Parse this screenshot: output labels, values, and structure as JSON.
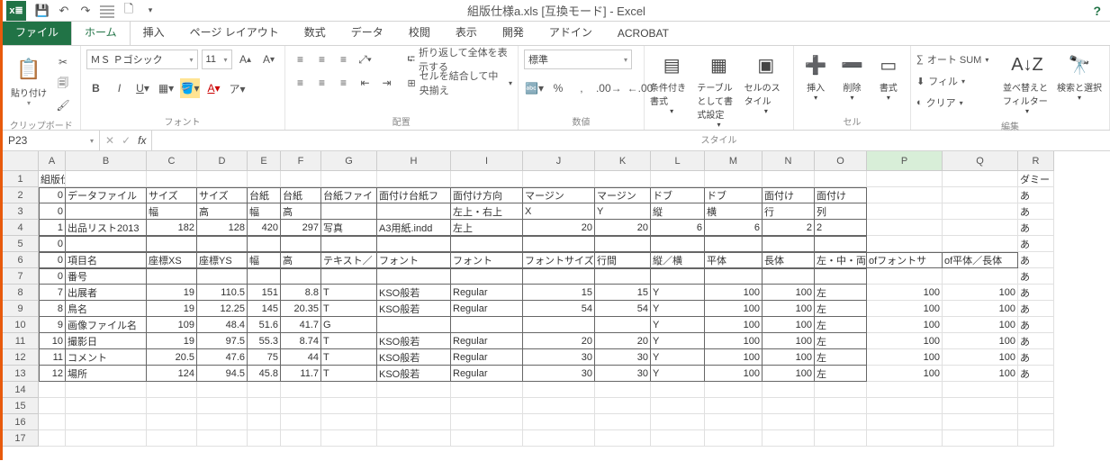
{
  "title": "組版仕様a.xls  [互換モード] - Excel",
  "qat": {
    "save": "save-icon",
    "undo": "undo-icon",
    "redo": "redo-icon",
    "new": "new-doc-icon"
  },
  "tabs": [
    "ファイル",
    "ホーム",
    "挿入",
    "ページ レイアウト",
    "数式",
    "データ",
    "校閲",
    "表示",
    "開発",
    "アドイン",
    "ACROBAT"
  ],
  "active_tab": 1,
  "ribbon": {
    "clipboard": {
      "label": "クリップボード",
      "paste": "貼り付け"
    },
    "font": {
      "label": "フォント",
      "name": "ＭＳ Ｐゴシック",
      "size": "11"
    },
    "alignment": {
      "label": "配置",
      "wrap": "折り返して全体を表示する",
      "merge": "セルを結合して中央揃え"
    },
    "number": {
      "label": "数値",
      "format": "標準"
    },
    "styles": {
      "label": "スタイル",
      "cond": "条件付き書式",
      "tbl": "テーブルとして書式設定",
      "cell": "セルのスタイル"
    },
    "cells": {
      "label": "セル",
      "insert": "挿入",
      "delete": "削除",
      "format": "書式"
    },
    "editing": {
      "label": "編集",
      "sum": "オート SUM",
      "fill": "フィル",
      "clear": "クリア",
      "sort": "並べ替えとフィルター",
      "find": "検索と選択"
    }
  },
  "name_box": "P23",
  "fx_value": "",
  "col_widths": {
    "A": 30,
    "B": 90,
    "C": 56,
    "D": 56,
    "E": 37,
    "F": 45,
    "G": 62,
    "H": 82,
    "I": 80,
    "J": 80,
    "K": 62,
    "L": 60,
    "M": 64,
    "N": 58,
    "O": 58,
    "P": 84,
    "Q": 84,
    "R": 40
  },
  "row_count": 17,
  "active_col": "P",
  "active_row": 23,
  "grid": {
    "r1": {
      "A": "組版仕様",
      "R": "ダミー"
    },
    "r2": {
      "A": "0",
      "B": "データファイル",
      "C": "サイズ",
      "D": "サイズ",
      "E": "台紙",
      "F": "台紙",
      "G": "台紙ファイ",
      "H": "面付け台紙フ",
      "I": "面付け方向",
      "J": "マージン",
      "K": "マージン",
      "L": "ドブ",
      "M": "ドブ",
      "N": "面付け",
      "O": "面付け",
      "R": "あ"
    },
    "r3": {
      "A": "0",
      "C": "幅",
      "D": "高",
      "E": "幅",
      "F": "高",
      "I": "左上・右上",
      "J": "X",
      "K": "Y",
      "L": "縦",
      "M": "横",
      "N": "行",
      "O": "列",
      "R": "あ"
    },
    "r4": {
      "A": "1",
      "B": "出品リスト2013",
      "C": "182",
      "D": "128",
      "E": "420",
      "F": "297",
      "G": "写真",
      "H": "A3用紙.indd",
      "I": "左上",
      "J": "20",
      "K": "20",
      "L": "6",
      "M": "6",
      "N": "2",
      "O": "2",
      "R": "あ"
    },
    "r5": {
      "A": "0",
      "R": "あ"
    },
    "r6": {
      "A": "0",
      "B": "項目名",
      "C": "座標XS",
      "D": "座標YS",
      "E": "幅",
      "F": "高",
      "G": "テキスト／",
      "H": "フォント",
      "I": "フォント",
      "J": "フォントサイズ",
      "K": "行間",
      "L": "縦／横",
      "M": "平体",
      "N": "長体",
      "O": "左・中・両",
      "P": "ofフォントサ",
      "Q": "of平体／長体",
      "R": "あ"
    },
    "r7": {
      "A": "0",
      "B": "番号",
      "R": "あ"
    },
    "r8": {
      "A": "7",
      "B": "出展者",
      "C": "19",
      "D": "110.5",
      "E": "151",
      "F": "8.8",
      "G": "T",
      "H": "KSO般若",
      "I": "Regular",
      "J": "15",
      "K": "15",
      "L": "Y",
      "M": "100",
      "N": "100",
      "O": "左",
      "P": "100",
      "Q": "100",
      "R": "あ"
    },
    "r9": {
      "A": "8",
      "B": "鳥名",
      "C": "19",
      "D": "12.25",
      "E": "145",
      "F": "20.35",
      "G": "T",
      "H": "KSO般若",
      "I": "Regular",
      "J": "54",
      "K": "54",
      "L": "Y",
      "M": "100",
      "N": "100",
      "O": "左",
      "P": "100",
      "Q": "100",
      "R": "あ"
    },
    "r10": {
      "A": "9",
      "B": "画像ファイル名",
      "C": "109",
      "D": "48.4",
      "E": "51.6",
      "F": "41.7",
      "G": "G",
      "L": "Y",
      "M": "100",
      "N": "100",
      "O": "左",
      "P": "100",
      "Q": "100",
      "R": "あ"
    },
    "r11": {
      "A": "10",
      "B": "撮影日",
      "C": "19",
      "D": "97.5",
      "E": "55.3",
      "F": "8.74",
      "G": "T",
      "H": "KSO般若",
      "I": "Regular",
      "J": "20",
      "K": "20",
      "L": "Y",
      "M": "100",
      "N": "100",
      "O": "左",
      "P": "100",
      "Q": "100",
      "R": "あ"
    },
    "r12": {
      "A": "11",
      "B": "コメント",
      "C": "20.5",
      "D": "47.6",
      "E": "75",
      "F": "44",
      "G": "T",
      "H": "KSO般若",
      "I": "Regular",
      "J": "30",
      "K": "30",
      "L": "Y",
      "M": "100",
      "N": "100",
      "O": "左",
      "P": "100",
      "Q": "100",
      "R": "あ"
    },
    "r13": {
      "A": "12",
      "B": "場所",
      "C": "124",
      "D": "94.5",
      "E": "45.8",
      "F": "11.7",
      "G": "T",
      "H": "KSO般若",
      "I": "Regular",
      "J": "30",
      "K": "30",
      "L": "Y",
      "M": "100",
      "N": "100",
      "O": "左",
      "P": "100",
      "Q": "100",
      "R": "あ"
    }
  },
  "right_align_cols": [
    "A",
    "C",
    "D",
    "E",
    "F",
    "J",
    "K",
    "L_num",
    "M",
    "N",
    "P",
    "Q"
  ],
  "bordered_rows_thick": [
    2,
    3,
    4,
    5,
    6,
    7,
    8,
    9,
    10,
    11,
    12,
    13
  ],
  "columns": [
    "A",
    "B",
    "C",
    "D",
    "E",
    "F",
    "G",
    "H",
    "I",
    "J",
    "K",
    "L",
    "M",
    "N",
    "O",
    "P",
    "Q",
    "R"
  ]
}
